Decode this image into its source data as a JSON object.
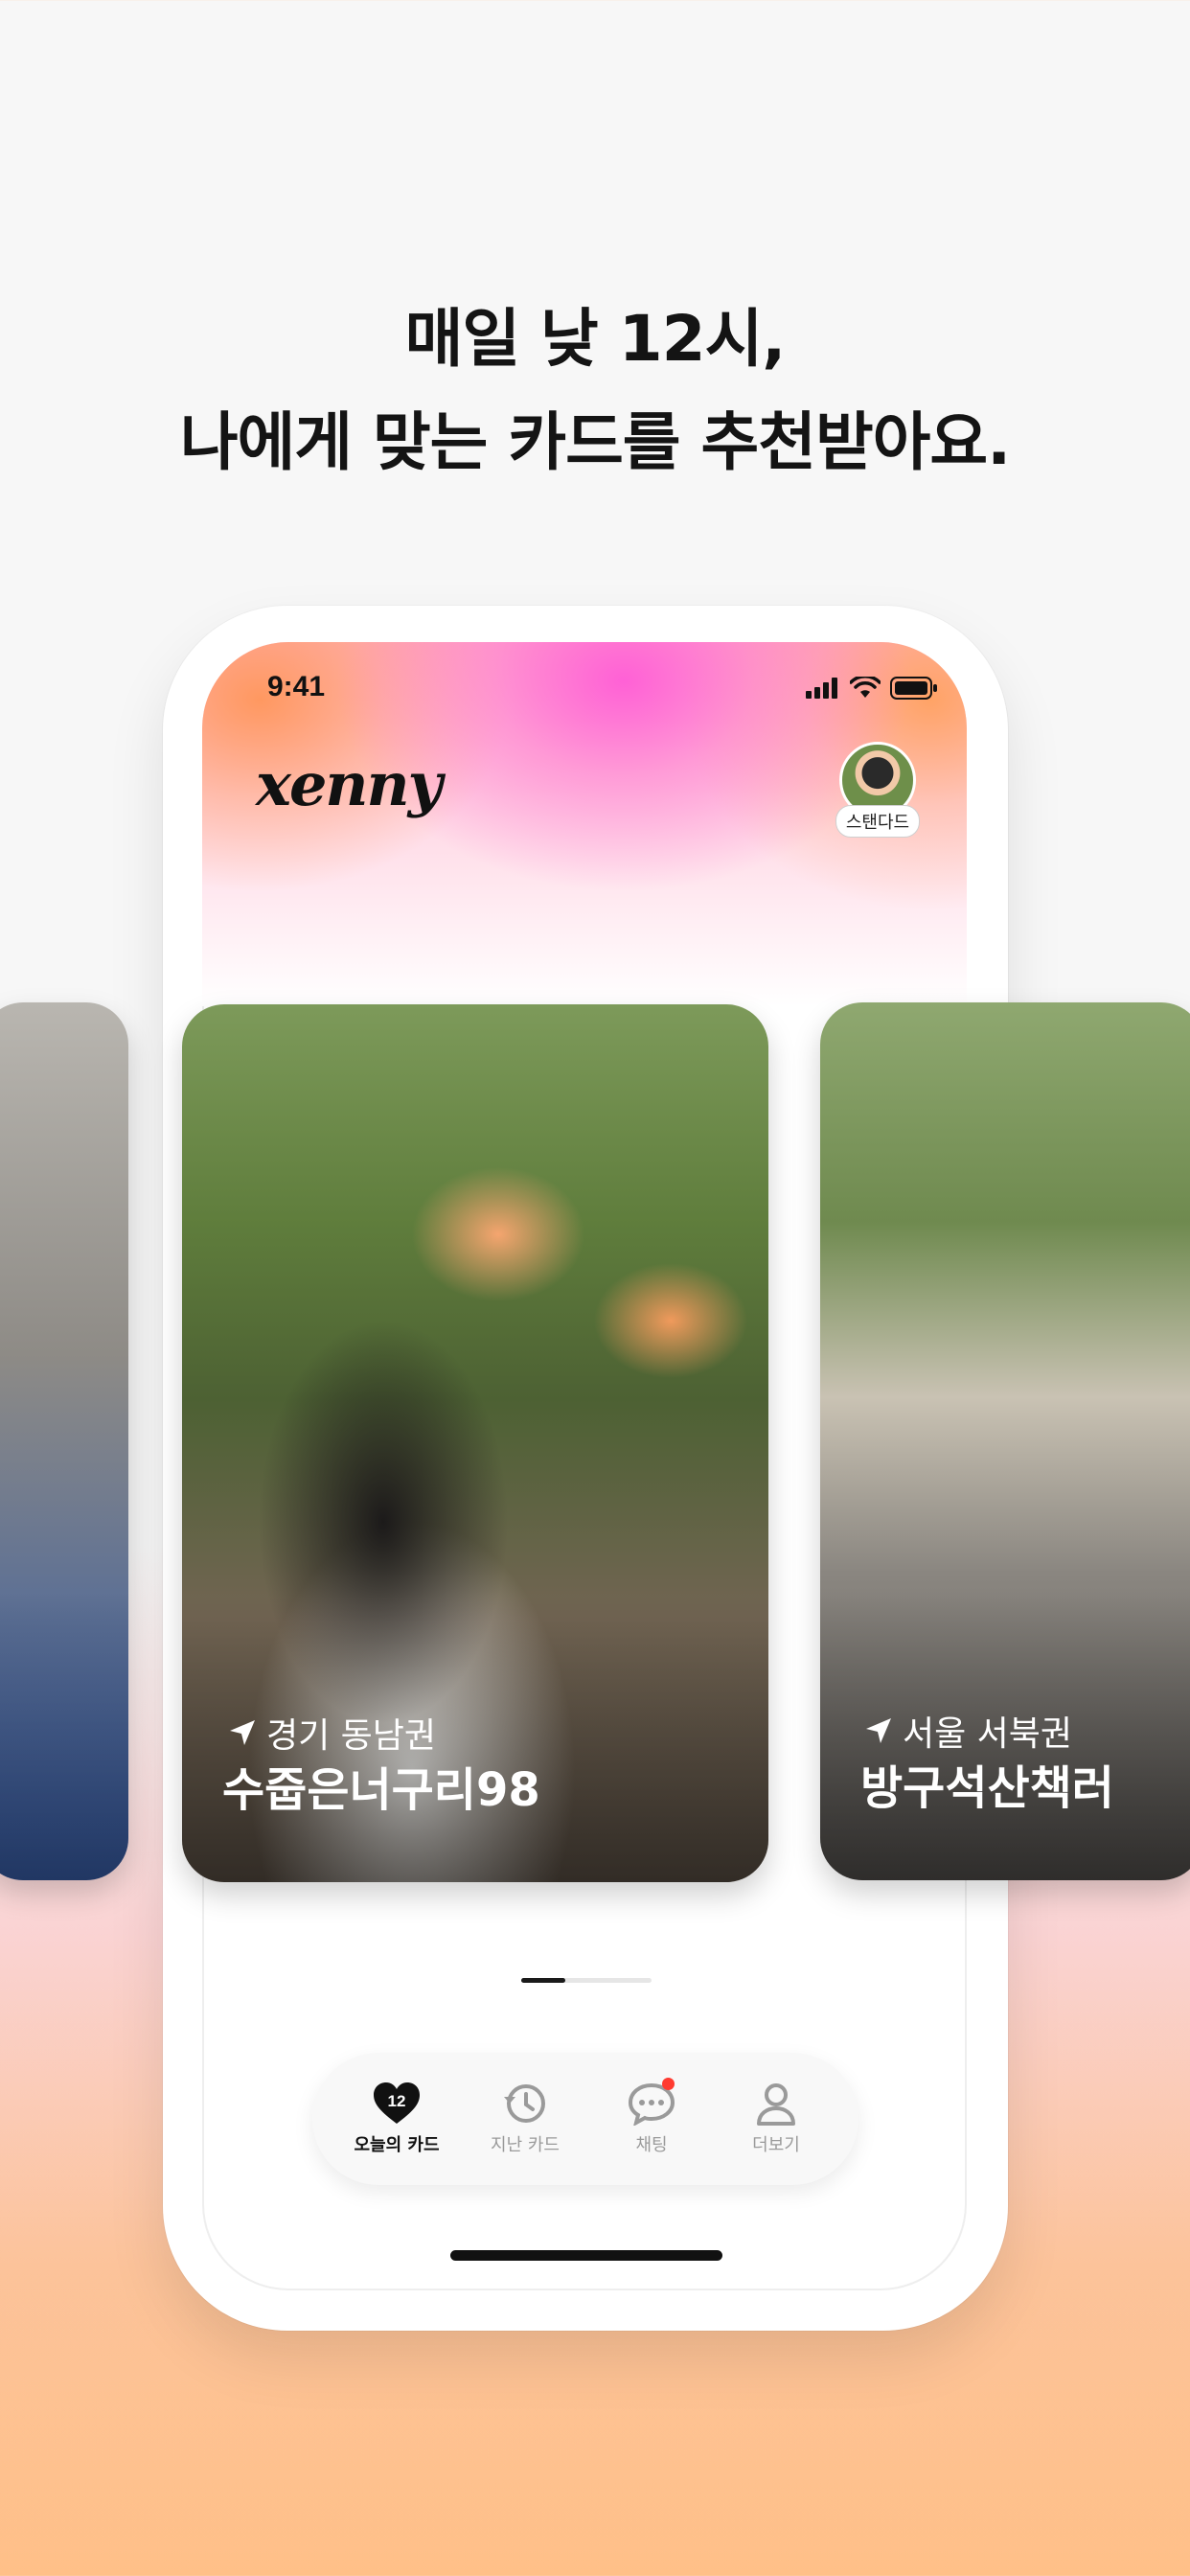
{
  "headline": {
    "line1": "매일 낮 12시,",
    "line2": "나에게 맞는 카드를 추천받아요."
  },
  "status_bar": {
    "time": "9:41",
    "icons": [
      "cellular-signal-icon",
      "wifi-icon",
      "battery-icon"
    ]
  },
  "app": {
    "logo_text": "xenny",
    "profile": {
      "badge": "스탠다드"
    }
  },
  "cards": [
    {
      "location": "",
      "nickname": ""
    },
    {
      "location": "경기 동남권",
      "nickname": "수줍은너구리98"
    },
    {
      "location": "서울 서북권",
      "nickname": "방구석산책러"
    }
  ],
  "pager": {
    "active_index": 0,
    "count": 3
  },
  "tabbar": {
    "items": [
      {
        "label": "오늘의 카드",
        "icon": "heart-icon",
        "badge": "12",
        "active": true
      },
      {
        "label": "지난 카드",
        "icon": "history-icon",
        "active": false
      },
      {
        "label": "채팅",
        "icon": "chat-bubble-icon",
        "has_new": true,
        "active": false
      },
      {
        "label": "더보기",
        "icon": "person-icon",
        "active": false
      }
    ]
  },
  "colors": {
    "accent_pink": "#ff5cd6",
    "accent_orange": "#ffa05a",
    "notification_red": "#ff3b30",
    "text_dark": "#141414"
  }
}
